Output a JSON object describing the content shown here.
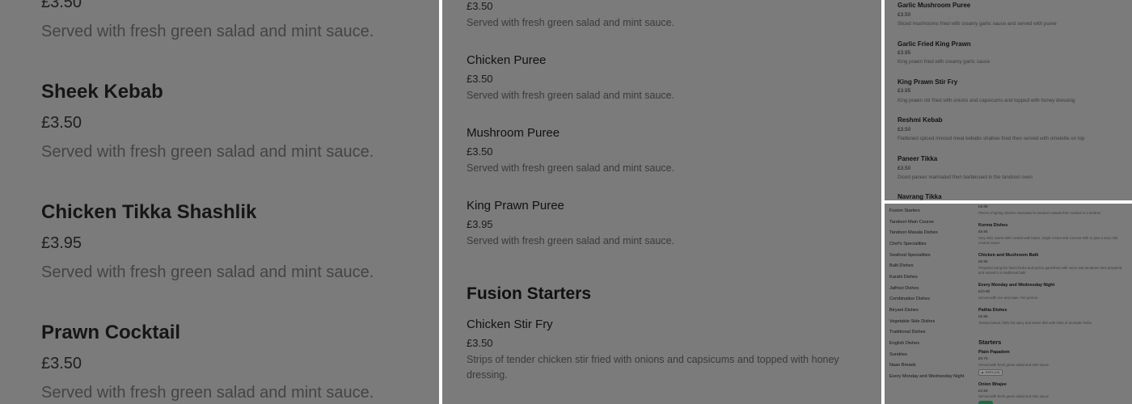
{
  "panel1": {
    "top_price": "£3.50",
    "top_desc": "Served with fresh green salad and mint sauce.",
    "items": [
      {
        "name": "Sheek Kebab",
        "price": "£3.50",
        "desc": "Served with fresh green salad and mint sauce."
      },
      {
        "name": "Chicken Tikka Shashlik",
        "price": "£3.95",
        "desc": "Served with fresh green salad and mint sauce."
      },
      {
        "name": "Prawn Cocktail",
        "price": "£3.50",
        "desc": "Served with fresh green salad and mint sauce."
      }
    ]
  },
  "panel2": {
    "top_price": "£3.50",
    "top_desc": "Served with fresh green salad and mint sauce.",
    "items": [
      {
        "name": "Chicken Puree",
        "price": "£3.50",
        "desc": "Served with fresh green salad and mint sauce."
      },
      {
        "name": "Mushroom Puree",
        "price": "£3.50",
        "desc": "Served with fresh green salad and mint sauce."
      },
      {
        "name": "King Prawn Puree",
        "price": "£3.95",
        "desc": "Served with fresh green salad and mint sauce."
      }
    ],
    "section_heading": "Fusion Starters",
    "section_item": {
      "name": "Chicken Stir Fry",
      "price": "£3.50",
      "desc": "Strips of tender chicken stir fried with onions and capsicums and topped with honey dressing."
    }
  },
  "panel3": {
    "items": [
      {
        "name": "Garlic Mushroom Puree",
        "price": "£3.50",
        "desc": "Sliced mushrooms fried with creamy garlic sauce and served with puree"
      },
      {
        "name": "Garlic Fried King Prawn",
        "price": "£3.95",
        "desc": "King prawn fried with creamy garlic sauce"
      },
      {
        "name": "King Prawn Stir Fry",
        "price": "£3.95",
        "desc": "King prawn stir fried with onions and capsicums and topped with honey dressing"
      },
      {
        "name": "Reshmi Kebab",
        "price": "£3.50",
        "desc": "Flattened spiced minced meat kebabs shallow fried then served with omelette on top"
      },
      {
        "name": "Paneer Tikka",
        "price": "£3.50",
        "desc": "Diced paneer marinated then barbecued in the tandoori oven"
      }
    ],
    "cut_item_name": "Navrang Tikka"
  },
  "panel4": {
    "categories": [
      "Fusion Starters",
      "Tandoori Main Course",
      "Tandoori Masala Dishes",
      "Chef's Specialities",
      "Seafood Specialities",
      "Balti Dishes",
      "Karahi Dishes",
      "Jalfrezi Dishes",
      "Combination Dishes",
      "Biryani Dishes",
      "Vegetable Side Dishes",
      "Traditional Dishes",
      "English Dishes",
      "Sundries",
      "Naan Breads",
      "Every Monday and Wednesday Night"
    ],
    "top_price": "£8.95",
    "top_desc": "Pieces of spring chicken marinated in tandoori masala then cooked in a tandoor",
    "items": [
      {
        "name": "Korma Dishes",
        "price": "£5.95",
        "desc": "Very mild, sweet dish cooked with butter, single cream and coconut milk to give a very mild creamy sauce"
      },
      {
        "name": "Chicken and Mushroom Balti",
        "price": "£6.95",
        "desc": "Prepared using the finest herbs and spices garnished with onion and tomatoes then prepared and served in a traditional balti"
      },
      {
        "name": "Every Monday and Wednesday Night",
        "price": "£10.95",
        "desc": "Served with rice and naan. Per person."
      },
      {
        "name": "Pathia Dishes",
        "price": "£5.95",
        "desc": "Tomato based, fairly hot spicy and sweet dish with hints of aromatic herbs"
      }
    ],
    "section_heading": "Starters",
    "starters": [
      {
        "name": "Plain Papadom",
        "price": "£0.70",
        "desc": "Served with fresh green salad and mint sauce",
        "badge": "100% (13)"
      },
      {
        "name": "Onion Bhajee",
        "price": "£2.50",
        "desc": "Served with fresh green salad and mint sauce"
      }
    ]
  }
}
